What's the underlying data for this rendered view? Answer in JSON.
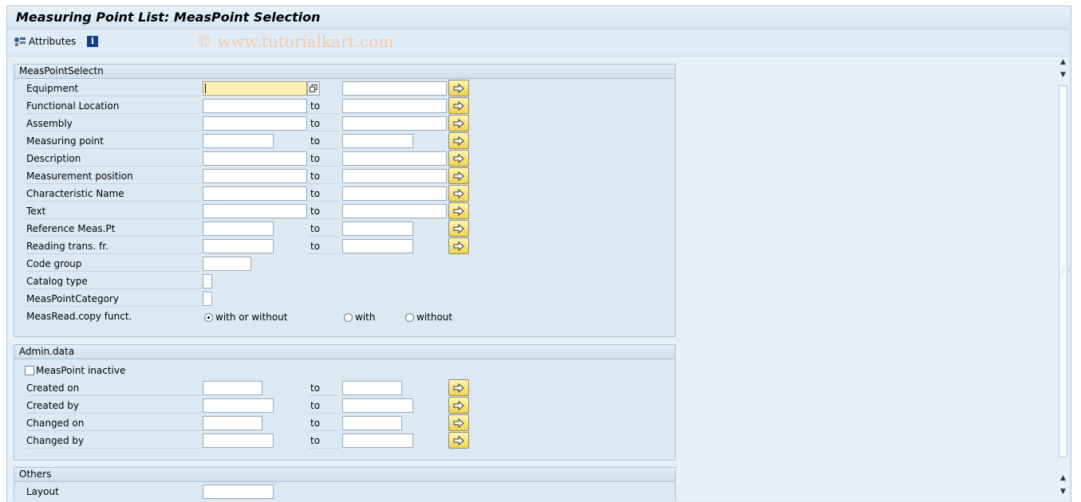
{
  "window": {
    "title": "Measuring Point List: MeasPoint Selection"
  },
  "toolbar": {
    "attributes_label": "Attributes",
    "info_icon_glyph": "i"
  },
  "watermark": "© www.tutorialkart.com",
  "to_label": "to",
  "groups": {
    "selection": {
      "title": "MeasPointSelectn",
      "fields": [
        {
          "label": "Equipment"
        },
        {
          "label": "Functional Location"
        },
        {
          "label": "Assembly"
        },
        {
          "label": "Measuring point"
        },
        {
          "label": "Description"
        },
        {
          "label": "Measurement position"
        },
        {
          "label": "Characteristic Name"
        },
        {
          "label": "Text"
        },
        {
          "label": "Reference Meas.Pt"
        },
        {
          "label": "Reading trans. fr."
        },
        {
          "label": "Code group"
        },
        {
          "label": "Catalog type"
        },
        {
          "label": "MeasPointCategory"
        }
      ],
      "copy_function": {
        "label": "MeasRead.copy funct.",
        "options": [
          "with or without",
          "with",
          "without"
        ],
        "selected": "with or without"
      }
    },
    "admin": {
      "title": "Admin.data",
      "inactive_checkbox": {
        "label": "MeasPoint inactive",
        "checked": false
      },
      "fields": [
        {
          "label": "Created on"
        },
        {
          "label": "Created by"
        },
        {
          "label": "Changed on"
        },
        {
          "label": "Changed by"
        }
      ]
    },
    "others": {
      "title": "Others",
      "fields": [
        {
          "label": "Layout"
        }
      ]
    }
  },
  "colors": {
    "background": "#dfebf5",
    "group_background": "#dce9f3",
    "focused_input": "#faf1b3",
    "multi_select_button": "#f0d34e"
  }
}
